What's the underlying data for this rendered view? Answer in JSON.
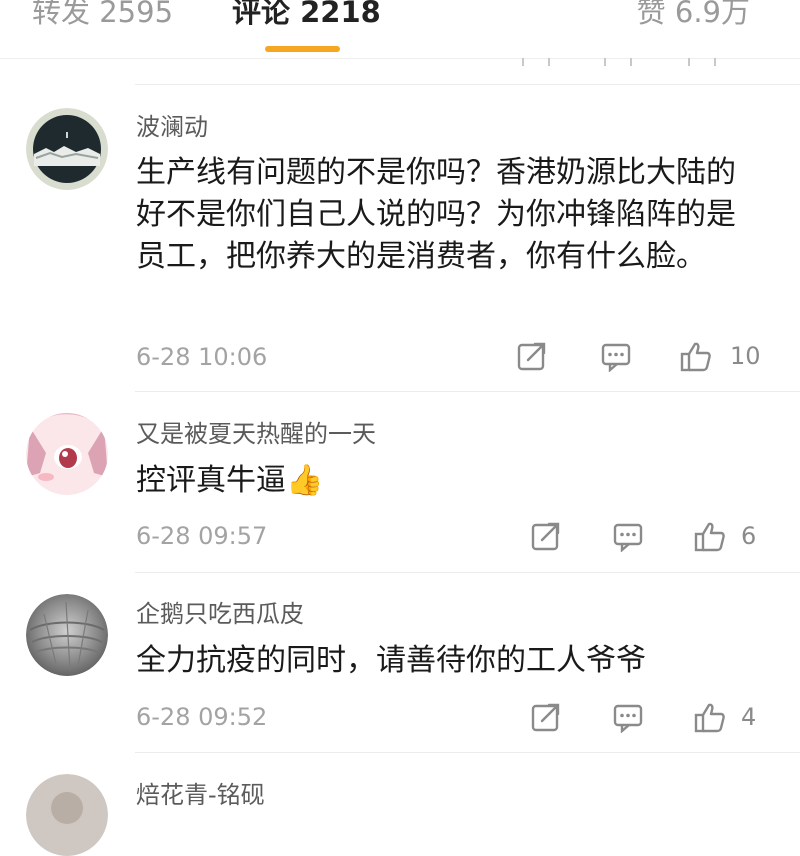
{
  "tabs": {
    "reposts": "转发 2595",
    "comments": "评论 2218",
    "likes": "赞 6.9万"
  },
  "comments": [
    {
      "username": "波澜动",
      "text": "生产线有问题的不是你吗？香港奶源比大陆的好不是你们自己人说的吗？为你冲锋陷阵的是员工，把你养大的是消费者，你有什么脸。",
      "time": "6-28 10:06",
      "likes": "10"
    },
    {
      "username": "又是被夏天热醒的一天",
      "text": "控评真牛逼👍",
      "time": "6-28 09:57",
      "likes": "6"
    },
    {
      "username": "企鹅只吃西瓜皮",
      "text": "全力抗疫的同时，请善待你的工人爷爷",
      "time": "6-28 09:52",
      "likes": "4"
    },
    {
      "username": "焙花青-铭砚"
    }
  ],
  "colors": {
    "accent": "#f5a623",
    "username": "#5b5b5b",
    "meta": "#a3a3a3"
  },
  "icons": [
    "share-icon",
    "comment-icon",
    "like-icon"
  ]
}
